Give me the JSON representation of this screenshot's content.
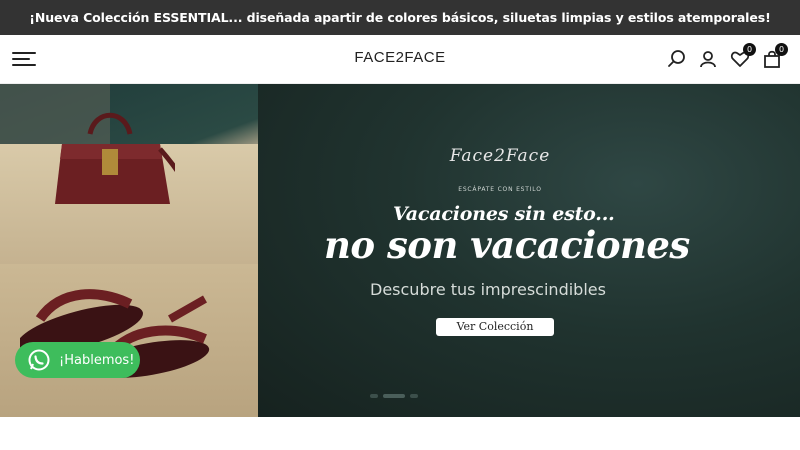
{
  "announcement": {
    "text": "¡Nueva Colección ESSENTIAL... diseñada apartir de colores básicos, siluetas limpias y estilos atemporales!"
  },
  "header": {
    "logo": "FACE2FACE",
    "wishlist_count": "0",
    "cart_count": "0",
    "icons": [
      "menu-icon",
      "search-icon",
      "user-icon",
      "heart-icon",
      "bag-icon"
    ]
  },
  "hero": {
    "brand_script": "Face2Face",
    "tagline": "ESCÁPATE CON ESTILO",
    "headline_small": "Vacaciones sin esto...",
    "headline_large": "no son vacaciones",
    "subheadline": "Descubre tus imprescindibles",
    "cta_label": "Ver Colección",
    "slide_dots": 3,
    "active_slide": 2
  },
  "whatsapp": {
    "label": "¡Hablemos!",
    "color": "#3ebd5c"
  },
  "colors": {
    "announcement_bg": "#333333",
    "accent_green": "#3ebd5c"
  }
}
